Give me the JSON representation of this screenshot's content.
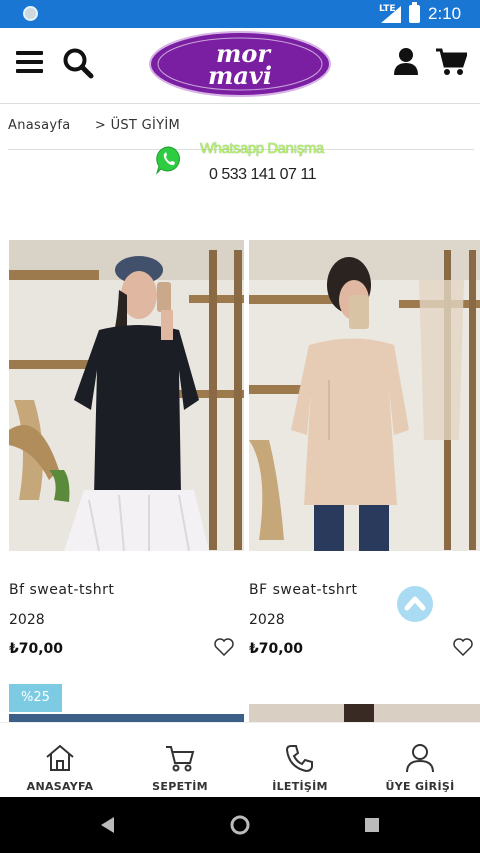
{
  "status_bar": {
    "time": "2:10",
    "network": "LTE"
  },
  "header": {
    "logo_line1": "mor",
    "logo_line2": "mavi",
    "brand_color": "#7b1fa2",
    "icons": [
      "menu-icon",
      "search-icon",
      "user-icon",
      "cart-icon"
    ]
  },
  "breadcrumb": {
    "home": "Anasayfa",
    "separator": ">",
    "current": "ÜST GİYİM"
  },
  "whatsapp": {
    "title": "Whatsapp Danışma",
    "phone": "0 533 141 07 11"
  },
  "products": [
    {
      "name": "Bf sweat-tshrt",
      "code": "2028",
      "price": "₺70,00",
      "color": "#1c1e26"
    },
    {
      "name": "BF sweat-tshrt",
      "code": "2028",
      "price": "₺70,00",
      "color": "#e6ccb4"
    }
  ],
  "discount_badge": "%25",
  "bottom_nav": [
    {
      "label": "ANASAYFA",
      "icon": "home-icon"
    },
    {
      "label": "SEPETİM",
      "icon": "cart-icon"
    },
    {
      "label": "İLETİŞİM",
      "icon": "phone-icon"
    },
    {
      "label": "ÜYE GİRİŞİ",
      "icon": "user-icon"
    }
  ],
  "colors": {
    "status_bar": "#1976d2",
    "accent": "#7ccbe3",
    "scroll_top": "#a9dcf2"
  }
}
